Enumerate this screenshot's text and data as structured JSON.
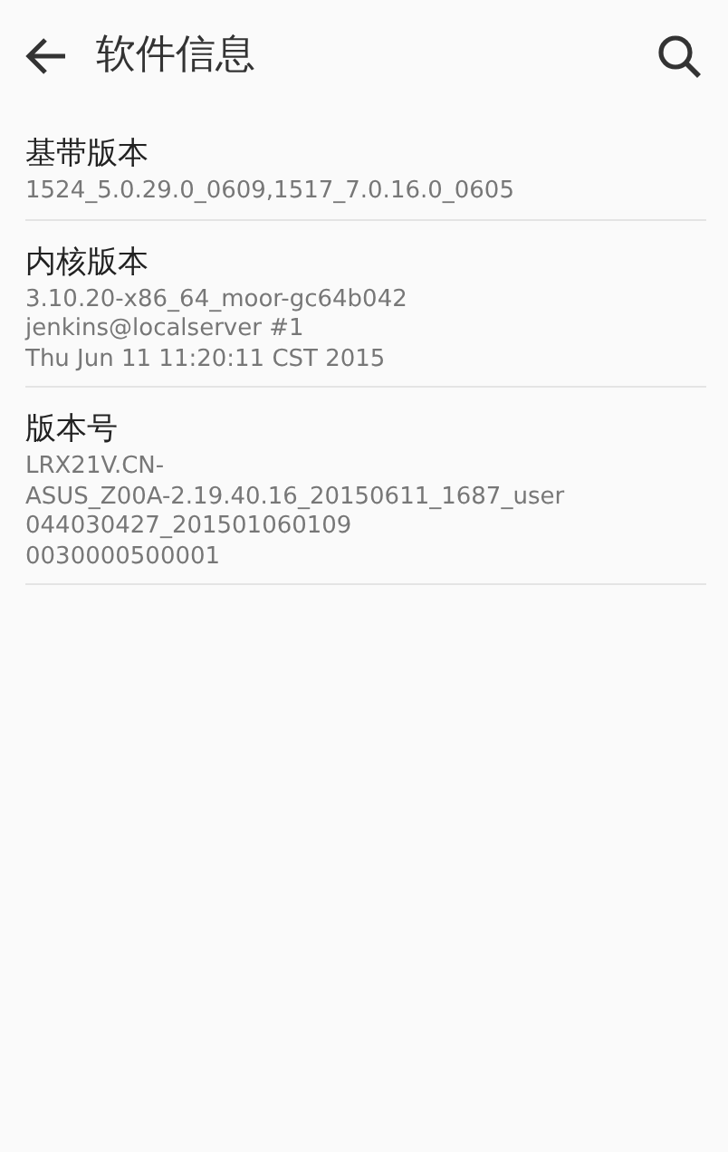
{
  "app_bar": {
    "title": "软件信息"
  },
  "items": [
    {
      "title": "基带版本",
      "lines": [
        "1524_5.0.29.0_0609,1517_7.0.16.0_0605"
      ]
    },
    {
      "title": "内核版本",
      "lines": [
        "3.10.20-x86_64_moor-gc64b042",
        "jenkins@localserver #1",
        "Thu Jun 11 11:20:11 CST 2015"
      ]
    },
    {
      "title": "版本号",
      "lines": [
        "LRX21V.CN-",
        "ASUS_Z00A-2.19.40.16_20150611_1687_user",
        "044030427_201501060109",
        "0030000500001"
      ]
    }
  ]
}
